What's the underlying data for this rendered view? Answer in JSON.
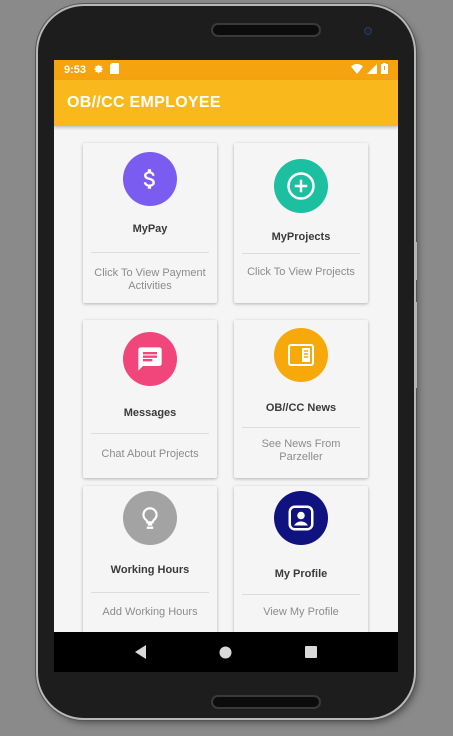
{
  "status_bar": {
    "time": "9:53",
    "icons": [
      "gear-icon",
      "sd-card-icon"
    ],
    "right_icons": [
      "wifi-icon",
      "signal-icon",
      "battery-icon"
    ]
  },
  "app_bar": {
    "title": "OB//CC EMPLOYEE"
  },
  "cards": [
    {
      "title": "MyPay",
      "subtitle": "Click To View Payment Activities",
      "icon": "dollar-icon",
      "color": "#7b5cf0"
    },
    {
      "title": "MyProjects",
      "subtitle": "Click To View Projects",
      "icon": "add-circle-icon",
      "color": "#1cbf9f"
    },
    {
      "title": "Messages",
      "subtitle": "Chat About Projects",
      "icon": "message-icon",
      "color": "#f0467c"
    },
    {
      "title": "OB//CC News",
      "subtitle": "See News From Parzeller",
      "icon": "news-icon",
      "color": "#f7a90c"
    },
    {
      "title": "Working Hours",
      "subtitle": "Add Working Hours",
      "icon": "lightbulb-icon",
      "color": "#a3a3a3"
    },
    {
      "title": "My Profile",
      "subtitle": "View My Profile",
      "icon": "profile-icon",
      "color": "#10137f"
    }
  ],
  "nav_bar": {
    "icons": [
      "back-icon",
      "home-icon",
      "recents-icon"
    ]
  }
}
